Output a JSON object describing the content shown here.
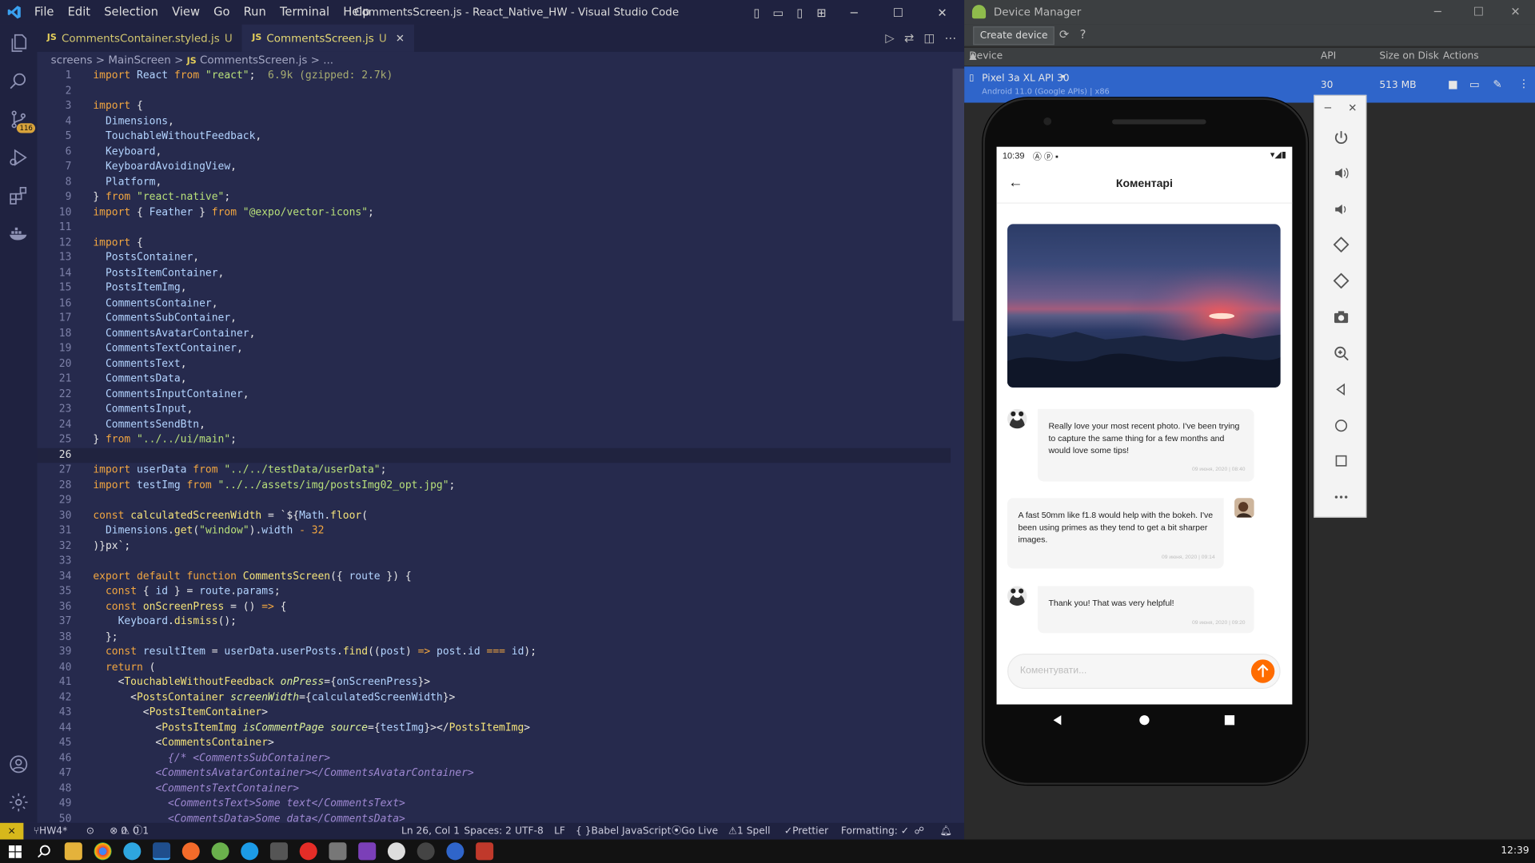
{
  "vscode": {
    "title": "CommentsScreen.js - React_Native_HW - Visual Studio Code",
    "menu": [
      "File",
      "Edit",
      "Selection",
      "View",
      "Go",
      "Run",
      "Terminal",
      "Help"
    ],
    "tabs": [
      {
        "icon": "JS",
        "label": "CommentsContainer.styled.js",
        "status": "U",
        "active": false
      },
      {
        "icon": "JS",
        "label": "CommentsScreen.js",
        "status": "U",
        "active": true
      }
    ],
    "breadcrumb": [
      "screens",
      ">",
      "MainScreen",
      ">",
      "JS",
      "CommentsScreen.js",
      ">",
      "..."
    ],
    "source_control_badge": "116",
    "code_lines": [
      [
        [
          "k",
          "import "
        ],
        [
          "v",
          "React "
        ],
        [
          "k",
          "from "
        ],
        [
          "s",
          "\"react\""
        ],
        [
          "p",
          ";  "
        ],
        [
          "dim",
          "6.9k (gzipped: 2.7k)"
        ]
      ],
      [],
      [
        [
          "k",
          "import "
        ],
        [
          "p",
          "{"
        ]
      ],
      [
        [
          "p",
          "  "
        ],
        [
          "v",
          "Dimensions"
        ],
        [
          "p",
          ","
        ]
      ],
      [
        [
          "p",
          "  "
        ],
        [
          "v",
          "TouchableWithoutFeedback"
        ],
        [
          "p",
          ","
        ]
      ],
      [
        [
          "p",
          "  "
        ],
        [
          "v",
          "Keyboard"
        ],
        [
          "p",
          ","
        ]
      ],
      [
        [
          "p",
          "  "
        ],
        [
          "v",
          "KeyboardAvoidingView"
        ],
        [
          "p",
          ","
        ]
      ],
      [
        [
          "p",
          "  "
        ],
        [
          "v",
          "Platform"
        ],
        [
          "p",
          ","
        ]
      ],
      [
        [
          "p",
          "} "
        ],
        [
          "k",
          "from "
        ],
        [
          "s",
          "\"react-native\""
        ],
        [
          "p",
          ";"
        ]
      ],
      [
        [
          "k",
          "import "
        ],
        [
          "p",
          "{ "
        ],
        [
          "v",
          "Feather "
        ],
        [
          "p",
          "} "
        ],
        [
          "k",
          "from "
        ],
        [
          "s",
          "\"@expo/vector-icons\""
        ],
        [
          "p",
          ";"
        ]
      ],
      [],
      [
        [
          "k",
          "import "
        ],
        [
          "p",
          "{"
        ]
      ],
      [
        [
          "p",
          "  "
        ],
        [
          "v",
          "PostsContainer"
        ],
        [
          "p",
          ","
        ]
      ],
      [
        [
          "p",
          "  "
        ],
        [
          "v",
          "PostsItemContainer"
        ],
        [
          "p",
          ","
        ]
      ],
      [
        [
          "p",
          "  "
        ],
        [
          "v",
          "PostsItemImg"
        ],
        [
          "p",
          ","
        ]
      ],
      [
        [
          "p",
          "  "
        ],
        [
          "v",
          "CommentsContainer"
        ],
        [
          "p",
          ","
        ]
      ],
      [
        [
          "p",
          "  "
        ],
        [
          "v",
          "CommentsSubContainer"
        ],
        [
          "p",
          ","
        ]
      ],
      [
        [
          "p",
          "  "
        ],
        [
          "v",
          "CommentsAvatarContainer"
        ],
        [
          "p",
          ","
        ]
      ],
      [
        [
          "p",
          "  "
        ],
        [
          "v",
          "CommentsTextContainer"
        ],
        [
          "p",
          ","
        ]
      ],
      [
        [
          "p",
          "  "
        ],
        [
          "v",
          "CommentsText"
        ],
        [
          "p",
          ","
        ]
      ],
      [
        [
          "p",
          "  "
        ],
        [
          "v",
          "CommentsData"
        ],
        [
          "p",
          ","
        ]
      ],
      [
        [
          "p",
          "  "
        ],
        [
          "v",
          "CommentsInputContainer"
        ],
        [
          "p",
          ","
        ]
      ],
      [
        [
          "p",
          "  "
        ],
        [
          "v",
          "CommentsInput"
        ],
        [
          "p",
          ","
        ]
      ],
      [
        [
          "p",
          "  "
        ],
        [
          "v",
          "CommentsSendBtn"
        ],
        [
          "p",
          ","
        ]
      ],
      [
        [
          "p",
          "} "
        ],
        [
          "k",
          "from "
        ],
        [
          "s",
          "\"../../ui/main\""
        ],
        [
          "p",
          ";"
        ]
      ],
      [],
      [
        [
          "k",
          "import "
        ],
        [
          "v",
          "userData "
        ],
        [
          "k",
          "from "
        ],
        [
          "s",
          "\"../../testData/userData\""
        ],
        [
          "p",
          ";"
        ]
      ],
      [
        [
          "k",
          "import "
        ],
        [
          "v",
          "testImg "
        ],
        [
          "k",
          "from "
        ],
        [
          "s",
          "\"../../assets/img/postsImg02_opt.jpg\""
        ],
        [
          "p",
          ";"
        ]
      ],
      [],
      [
        [
          "k",
          "const "
        ],
        [
          "fn",
          "calculatedScreenWidth "
        ],
        [
          "p",
          "= `${"
        ],
        [
          "v",
          "Math"
        ],
        [
          "p",
          "."
        ],
        [
          "fn",
          "floor"
        ],
        [
          "p",
          "("
        ]
      ],
      [
        [
          "p",
          "  "
        ],
        [
          "v",
          "Dimensions"
        ],
        [
          "p",
          "."
        ],
        [
          "fn",
          "get"
        ],
        [
          "p",
          "("
        ],
        [
          "s",
          "\"window\""
        ],
        [
          "p",
          ")."
        ],
        [
          "v",
          "width "
        ],
        [
          "k",
          "- "
        ],
        [
          "k",
          "32"
        ]
      ],
      [
        [
          "p",
          ")}px`;"
        ]
      ],
      [],
      [
        [
          "k",
          "export default function "
        ],
        [
          "fn",
          "CommentsScreen"
        ],
        [
          "p",
          "({ "
        ],
        [
          "v",
          "route "
        ],
        [
          "p",
          "}) {"
        ]
      ],
      [
        [
          "p",
          "  "
        ],
        [
          "k",
          "const "
        ],
        [
          "p",
          "{ "
        ],
        [
          "v",
          "id "
        ],
        [
          "p",
          "} = "
        ],
        [
          "v",
          "route"
        ],
        [
          "p",
          "."
        ],
        [
          "v",
          "params"
        ],
        [
          "p",
          ";"
        ]
      ],
      [
        [
          "p",
          "  "
        ],
        [
          "k",
          "const "
        ],
        [
          "fn",
          "onScreenPress "
        ],
        [
          "p",
          "= () "
        ],
        [
          "k",
          "=> "
        ],
        [
          "p",
          "{"
        ]
      ],
      [
        [
          "p",
          "    "
        ],
        [
          "v",
          "Keyboard"
        ],
        [
          "p",
          "."
        ],
        [
          "fn",
          "dismiss"
        ],
        [
          "p",
          "();"
        ]
      ],
      [
        [
          "p",
          "  };"
        ]
      ],
      [
        [
          "p",
          "  "
        ],
        [
          "k",
          "const "
        ],
        [
          "v",
          "resultItem "
        ],
        [
          "p",
          "= "
        ],
        [
          "v",
          "userData"
        ],
        [
          "p",
          "."
        ],
        [
          "v",
          "userPosts"
        ],
        [
          "p",
          "."
        ],
        [
          "fn",
          "find"
        ],
        [
          "p",
          "(("
        ],
        [
          "v",
          "post"
        ],
        [
          "p",
          ") "
        ],
        [
          "k",
          "=> "
        ],
        [
          "v",
          "post"
        ],
        [
          "p",
          "."
        ],
        [
          "v",
          "id "
        ],
        [
          "k",
          "=== "
        ],
        [
          "v",
          "id"
        ],
        [
          "p",
          ");"
        ]
      ],
      [
        [
          "p",
          "  "
        ],
        [
          "k",
          "return "
        ],
        [
          "p",
          "("
        ]
      ],
      [
        [
          "p",
          "    <"
        ],
        [
          "tag",
          "TouchableWithoutFeedback "
        ],
        [
          "at",
          "onPress"
        ],
        [
          "p",
          "={"
        ],
        [
          "v",
          "onScreenPress"
        ],
        [
          "p",
          "}>"
        ]
      ],
      [
        [
          "p",
          "      <"
        ],
        [
          "tag",
          "PostsContainer "
        ],
        [
          "at",
          "screenWidth"
        ],
        [
          "p",
          "={"
        ],
        [
          "v",
          "calculatedScreenWidth"
        ],
        [
          "p",
          "}>"
        ]
      ],
      [
        [
          "p",
          "        <"
        ],
        [
          "tag",
          "PostsItemContainer"
        ],
        [
          "p",
          ">"
        ]
      ],
      [
        [
          "p",
          "          <"
        ],
        [
          "tag",
          "PostsItemImg "
        ],
        [
          "at",
          "isCommentPage "
        ],
        [
          "at",
          "source"
        ],
        [
          "p",
          "={"
        ],
        [
          "v",
          "testImg"
        ],
        [
          "p",
          "}></"
        ],
        [
          "tag",
          "PostsItemImg"
        ],
        [
          "p",
          ">"
        ]
      ],
      [
        [
          "p",
          "          <"
        ],
        [
          "tag",
          "CommentsContainer"
        ],
        [
          "p",
          ">"
        ]
      ],
      [
        [
          "p",
          "            "
        ],
        [
          "c",
          "{/* <CommentsSubContainer>"
        ]
      ],
      [
        [
          "p",
          "          "
        ],
        [
          "c",
          "<CommentsAvatarContainer></CommentsAvatarContainer>"
        ]
      ],
      [
        [
          "p",
          "          "
        ],
        [
          "c",
          "<CommentsTextContainer>"
        ]
      ],
      [
        [
          "p",
          "            "
        ],
        [
          "c",
          "<CommentsText>Some text</CommentsText>"
        ]
      ],
      [
        [
          "p",
          "            "
        ],
        [
          "c",
          "<CommentsData>Some data</CommentsData>"
        ]
      ]
    ],
    "current_line": 26,
    "status": {
      "branch": "HW4*",
      "errors": "0",
      "warnings": "0",
      "info": "1",
      "position": "Ln 26, Col 1",
      "spaces": "Spaces: 2",
      "encoding": "UTF-8",
      "eol": "LF",
      "language": "Babel JavaScript",
      "golive": "Go Live",
      "spell": "1 Spell",
      "prettier": "Prettier",
      "formatting": "Formatting: ✓"
    }
  },
  "device_manager": {
    "title": "Device Manager",
    "create_button": "Create device",
    "help": "?",
    "columns": [
      "Device",
      "API",
      "Size on Disk",
      "Actions"
    ],
    "device": {
      "name": "Pixel 3a XL API 30",
      "subtitle": "Android 11.0 (Google APIs) | x86",
      "api": "30",
      "size": "513 MB"
    }
  },
  "app": {
    "status_time": "10:39",
    "header_title": "Коментарі",
    "comments": [
      {
        "text": "Really love your most recent photo. I've been trying to capture the same thing for a few months and would love some tips!",
        "date": "09 июня, 2020 | 08:40"
      },
      {
        "text": "A fast 50mm like f1.8 would help with the bokeh. I've been using primes as they tend to get a bit sharper images.",
        "date": "09 июня, 2020 | 09:14"
      },
      {
        "text": "Thank you! That was very helpful!",
        "date": "09 июня, 2020 | 09:20"
      }
    ],
    "input_placeholder": "Коментувати..."
  },
  "taskbar": {
    "clock": "12:39"
  },
  "colors": {
    "accent": "#ff6c00",
    "editor_bg": "#262a4d",
    "selection": "#2f65ca"
  }
}
